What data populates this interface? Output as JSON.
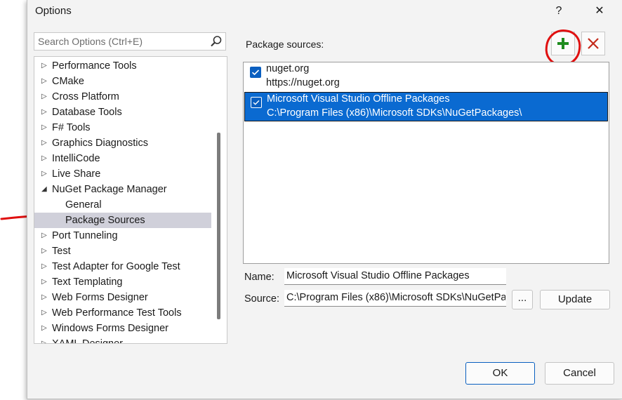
{
  "window": {
    "title": "Options",
    "help_glyph": "?",
    "close_glyph": "✕"
  },
  "search": {
    "placeholder": "Search Options (Ctrl+E)",
    "icon": "search-icon"
  },
  "tree": {
    "items": [
      {
        "label": "Performance Tools",
        "state": "collapsed"
      },
      {
        "label": "CMake",
        "state": "collapsed"
      },
      {
        "label": "Cross Platform",
        "state": "collapsed"
      },
      {
        "label": "Database Tools",
        "state": "collapsed"
      },
      {
        "label": "F# Tools",
        "state": "collapsed"
      },
      {
        "label": "Graphics Diagnostics",
        "state": "collapsed"
      },
      {
        "label": "IntelliCode",
        "state": "collapsed"
      },
      {
        "label": "Live Share",
        "state": "collapsed"
      },
      {
        "label": "NuGet Package Manager",
        "state": "expanded"
      },
      {
        "label": "General",
        "state": "child"
      },
      {
        "label": "Package Sources",
        "state": "child-selected"
      },
      {
        "label": "Port Tunneling",
        "state": "collapsed"
      },
      {
        "label": "Test",
        "state": "collapsed"
      },
      {
        "label": "Test Adapter for Google Test",
        "state": "collapsed"
      },
      {
        "label": "Text Templating",
        "state": "collapsed"
      },
      {
        "label": "Web Forms Designer",
        "state": "collapsed"
      },
      {
        "label": "Web Performance Test Tools",
        "state": "collapsed"
      },
      {
        "label": "Windows Forms Designer",
        "state": "collapsed"
      },
      {
        "label": "XAML Designer",
        "state": "collapsed"
      }
    ]
  },
  "package_sources": {
    "label": "Package sources:",
    "add_icon": "plus-icon",
    "remove_icon": "x-icon",
    "sources": [
      {
        "name": "nuget.org",
        "url": "https://nuget.org",
        "checked": true,
        "selected": false
      },
      {
        "name": "Microsoft Visual Studio Offline Packages",
        "url": "C:\\Program Files (x86)\\Microsoft SDKs\\NuGetPackages\\",
        "checked": true,
        "selected": true
      }
    ]
  },
  "form": {
    "name_label": "Name:",
    "name_value": "Microsoft Visual Studio Offline Packages",
    "source_label": "Source:",
    "source_value": "C:\\Program Files (x86)\\Microsoft SDKs\\NuGetPa",
    "browse_label": "...",
    "update_label": "Update"
  },
  "footer": {
    "ok_label": "OK",
    "cancel_label": "Cancel"
  },
  "colors": {
    "selection_blue": "#0a6ad1",
    "annotation_red": "#e01010",
    "add_green": "#1e8c1e",
    "remove_red": "#c42b1c"
  }
}
